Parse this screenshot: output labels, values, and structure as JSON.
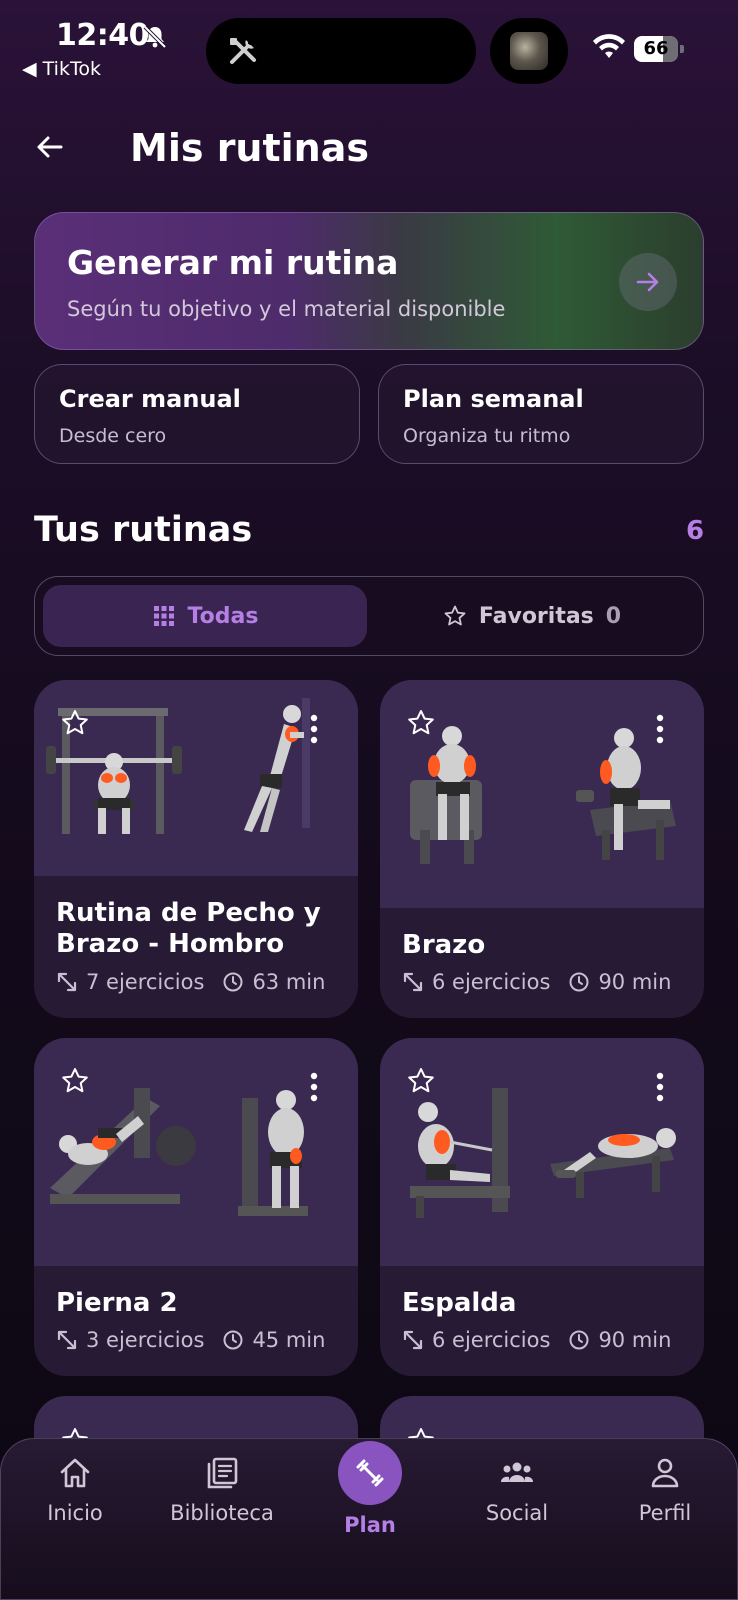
{
  "status_bar": {
    "time": "12:40",
    "back_app": "◀ TikTok",
    "battery": "66"
  },
  "header": {
    "title": "Mis rutinas"
  },
  "generate": {
    "title": "Generar mi rutina",
    "subtitle": "Según tu objetivo y el material disponible"
  },
  "options": [
    {
      "title": "Crear manual",
      "subtitle": "Desde cero"
    },
    {
      "title": "Plan semanal",
      "subtitle": "Organiza tu ritmo"
    }
  ],
  "section": {
    "title": "Tus rutinas",
    "count": "6"
  },
  "filters": {
    "all_label": "Todas",
    "fav_label": "Favoritas",
    "fav_count": "0"
  },
  "routines": [
    {
      "name": "Rutina de Pecho y Brazo - Hombro",
      "exercises": "7 ejercicios",
      "duration": "63 min"
    },
    {
      "name": "Brazo",
      "exercises": "6 ejercicios",
      "duration": "90 min"
    },
    {
      "name": "Pierna 2",
      "exercises": "3 ejercicios",
      "duration": "45 min"
    },
    {
      "name": "Espalda",
      "exercises": "6 ejercicios",
      "duration": "90 min"
    }
  ],
  "nav": {
    "items": [
      {
        "label": "Inicio",
        "icon": "home-icon"
      },
      {
        "label": "Biblioteca",
        "icon": "library-icon"
      },
      {
        "label": "Plan",
        "icon": "dumbbell-icon"
      },
      {
        "label": "Social",
        "icon": "group-icon"
      },
      {
        "label": "Perfil",
        "icon": "person-icon"
      }
    ]
  },
  "colors": {
    "accent": "#b57fe6",
    "accent_strong": "#8a54c0",
    "card_image_bg": "#3a2a52",
    "card_bg": "#261a35",
    "muscle_highlight": "#ff5a1f"
  }
}
